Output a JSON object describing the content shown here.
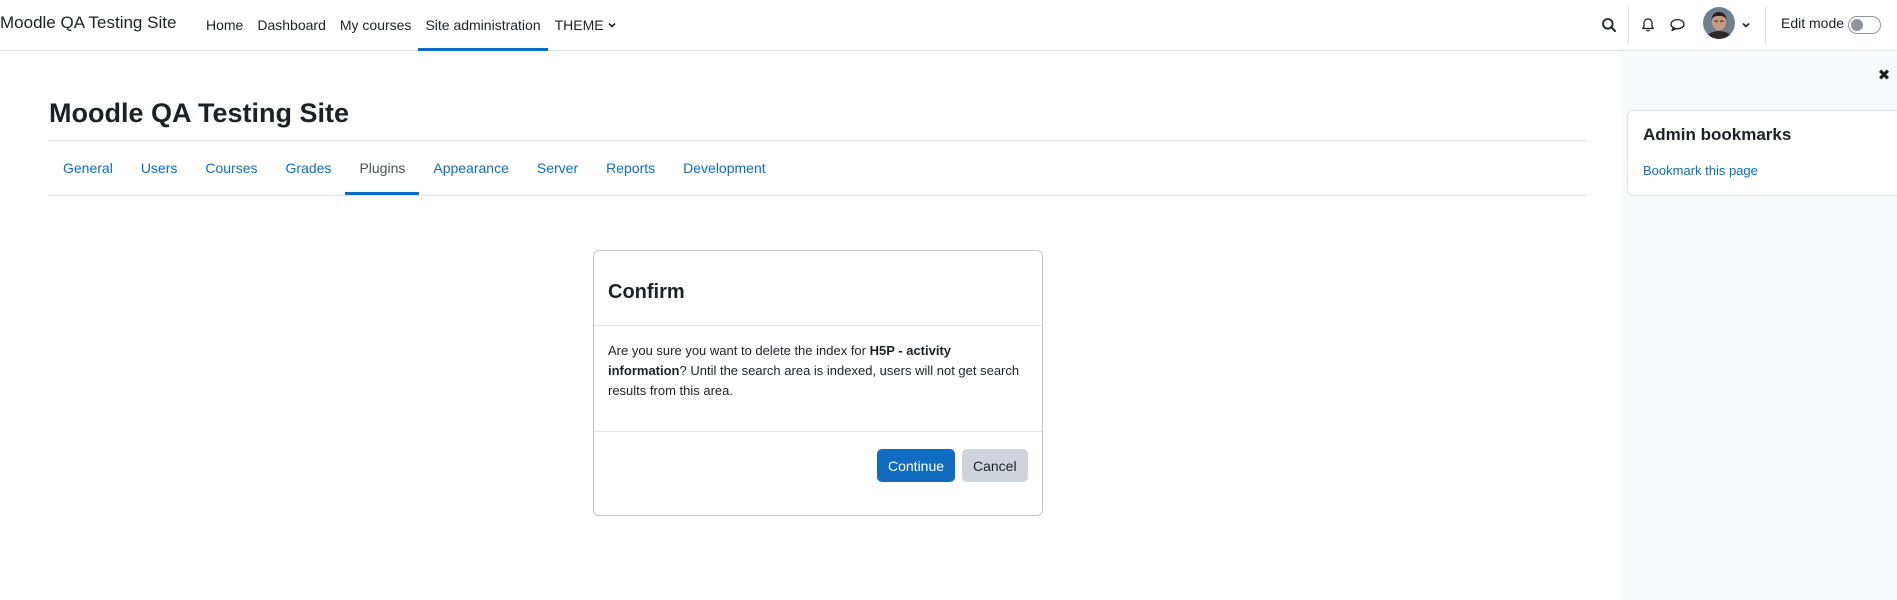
{
  "navbar": {
    "brand": "Moodle QA Testing Site",
    "items": [
      {
        "label": "Home"
      },
      {
        "label": "Dashboard"
      },
      {
        "label": "My courses"
      },
      {
        "label": "Site administration"
      },
      {
        "label": "THEME"
      }
    ],
    "edit_mode_label": "Edit mode"
  },
  "page": {
    "title": "Moodle QA Testing Site",
    "tabs": [
      {
        "label": "General"
      },
      {
        "label": "Users"
      },
      {
        "label": "Courses"
      },
      {
        "label": "Grades"
      },
      {
        "label": "Plugins"
      },
      {
        "label": "Appearance"
      },
      {
        "label": "Server"
      },
      {
        "label": "Reports"
      },
      {
        "label": "Development"
      }
    ]
  },
  "dialog": {
    "title": "Confirm",
    "body_pre": "Are you sure you want to delete the index for ",
    "body_bold": "H5P - activity information",
    "body_post": "? Until the search area is indexed, users will not get search results from this area.",
    "continue_label": "Continue",
    "cancel_label": "Cancel"
  },
  "drawer": {
    "close_icon": "✖",
    "block_title": "Admin bookmarks",
    "block_link": "Bookmark this page"
  },
  "colors": {
    "accent": "#0f6cbf",
    "border": "#dee2e6",
    "drawer_bg": "#f8f9fa"
  }
}
